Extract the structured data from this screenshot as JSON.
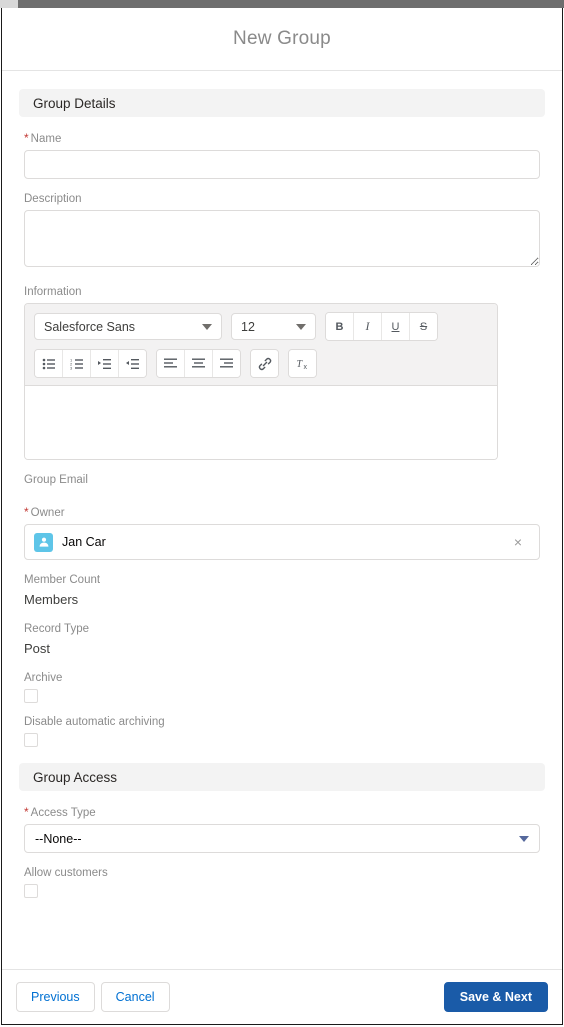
{
  "window": {
    "chrome_color": "#6e6e6e",
    "tab_color": "#d8d8d8"
  },
  "modal": {
    "title": "New Group"
  },
  "sections": {
    "group_details": {
      "title": "Group Details",
      "name": {
        "label": "Name",
        "required_marker": "*",
        "value": "",
        "placeholder": ""
      },
      "description": {
        "label": "Description",
        "value": "",
        "placeholder": ""
      },
      "information": {
        "label": "Information",
        "font_family_value": "Salesforce Sans",
        "font_size_value": "12",
        "body_value": "",
        "toolbar_row1": [
          {
            "name": "bold-icon",
            "glyph": "B"
          },
          {
            "name": "italic-icon",
            "glyph": "I"
          },
          {
            "name": "underline-icon",
            "glyph": "U"
          },
          {
            "name": "strikethrough-icon",
            "glyph": "S"
          }
        ],
        "toolbar_row2": [
          {
            "name": "bulleted-list-icon"
          },
          {
            "name": "numbered-list-icon"
          },
          {
            "name": "indent-icon"
          },
          {
            "name": "outdent-icon"
          },
          {
            "name": "align-left-icon"
          },
          {
            "name": "align-center-icon"
          },
          {
            "name": "align-right-icon"
          },
          {
            "name": "link-icon"
          },
          {
            "name": "remove-formatting-icon"
          }
        ]
      },
      "group_email": {
        "label": "Group Email"
      },
      "owner": {
        "label": "Owner",
        "required_marker": "*",
        "value": "Jan Car",
        "avatar_icon": "user-avatar-icon",
        "avatar_color": "#5ec5e8",
        "clear_glyph": "×"
      },
      "member_count": {
        "label": "Member Count",
        "value": "Members"
      },
      "record_type": {
        "label": "Record Type",
        "value": "Post"
      },
      "archive": {
        "label": "Archive",
        "checked": false
      },
      "disable_automatic_archiving": {
        "label": "Disable automatic archiving",
        "checked": false
      }
    },
    "group_access": {
      "title": "Group Access",
      "access_type": {
        "label": "Access Type",
        "required_marker": "*",
        "value": "--None--",
        "options": [
          "--None--"
        ]
      },
      "allow_customers": {
        "label": "Allow customers",
        "checked": false
      }
    }
  },
  "footer": {
    "previous_label": "Previous",
    "cancel_label": "Cancel",
    "save_label": "Save & Next",
    "brand_color": "#1a5ba8"
  }
}
